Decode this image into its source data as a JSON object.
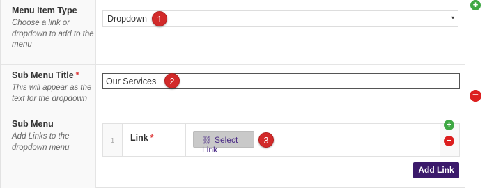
{
  "fields": {
    "menu_item_type": {
      "label": "Menu Item Type",
      "instructions": "Choose a link or dropdown to add to the menu",
      "selected": "Dropdown",
      "arrow": "▾",
      "badge": "1"
    },
    "sub_menu_title": {
      "label": "Sub Menu Title",
      "required": "*",
      "instructions": "This will appear as the text for the dropdown",
      "value": "Our Services",
      "badge": "2"
    },
    "sub_menu": {
      "label": "Sub Menu",
      "instructions": "Add Links to the dropdown menu",
      "rows": [
        {
          "order": "1",
          "link_label": "Link",
          "required": "*",
          "button_label": "Select Link",
          "badge": "3"
        }
      ],
      "add_button_label": "Add Link"
    }
  },
  "icons": {
    "plus": "+",
    "minus": "−",
    "link": "⛓"
  },
  "colors": {
    "accent": "#3b1a6b",
    "add_green": "#3fa844",
    "remove_red": "#dc1f1f",
    "badge_red": "#d22a2a",
    "required_red": "#dc3232"
  }
}
